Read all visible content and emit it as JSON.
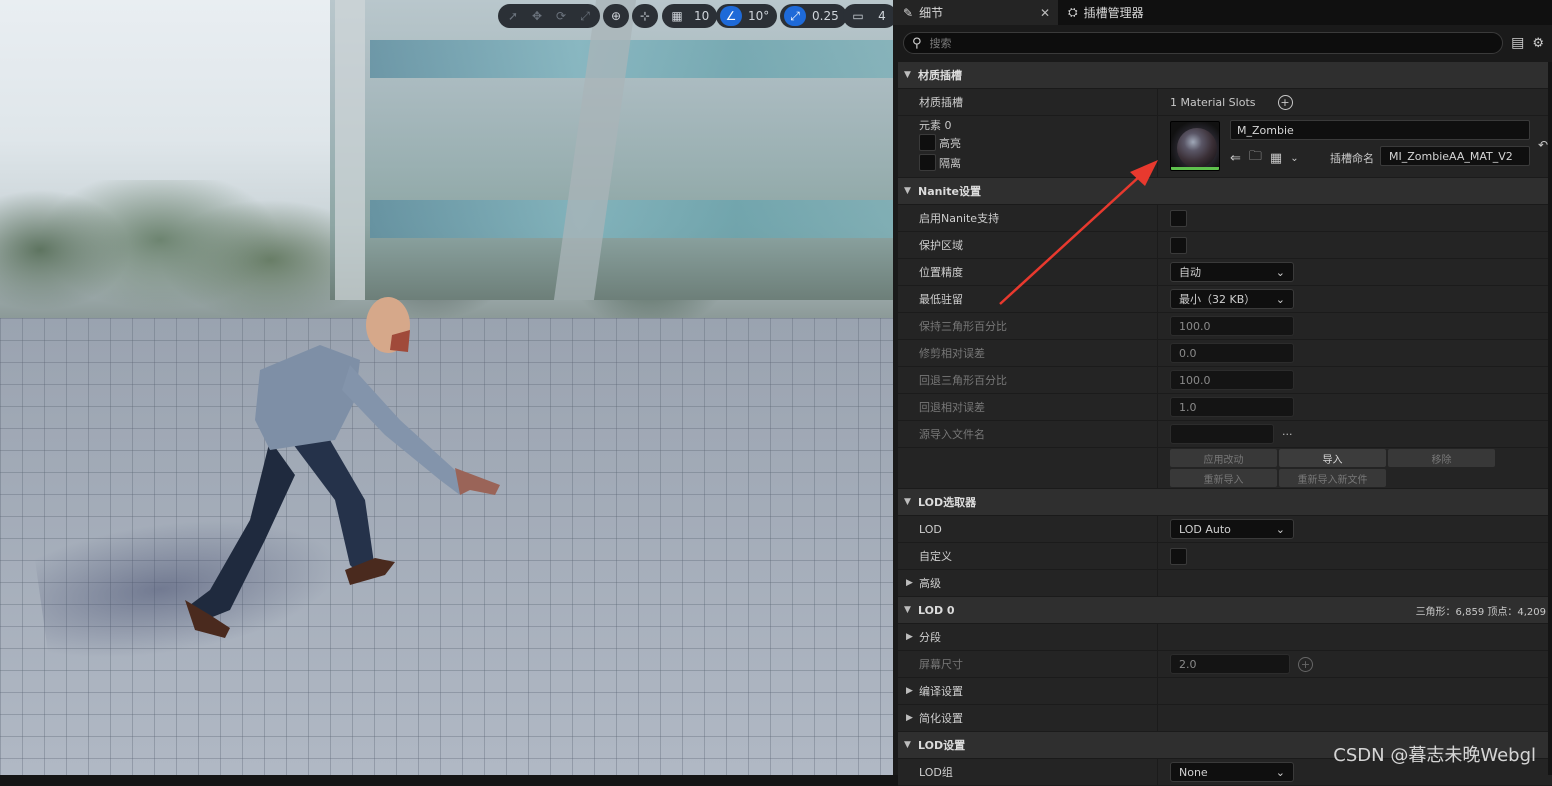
{
  "viewport": {
    "toolbar": {
      "grid_value": "10",
      "angle_value": "10°",
      "scale_value": "0.25",
      "camera_value": "4"
    }
  },
  "tabs": [
    {
      "label": "细节",
      "icon": "pencil-icon"
    },
    {
      "label": "插槽管理器",
      "icon": "socket-icon"
    }
  ],
  "search": {
    "placeholder": "搜索"
  },
  "sections": {
    "material": {
      "title": "材质插槽",
      "slots_label": "材质插槽",
      "slots_value": "1 Material Slots",
      "element_label": "元素 0",
      "highlight_label": "高亮",
      "isolate_label": "隔离",
      "material_name": "M_Zombie",
      "slot_name_label": "插槽命名",
      "slot_name_value": "MI_ZombieAA_MAT_V2"
    },
    "nanite": {
      "title": "Nanite设置",
      "enable_label": "启用Nanite支持",
      "preserve_label": "保护区域",
      "pos_precision_label": "位置精度",
      "pos_precision_value": "自动",
      "min_resident_label": "最低驻留",
      "min_resident_value": "最小（32 KB）",
      "keep_tri_label": "保持三角形百分比",
      "keep_tri_value": "100.0",
      "trim_err_label": "修剪相对误差",
      "trim_err_value": "0.0",
      "fallback_tri_label": "回退三角形百分比",
      "fallback_tri_value": "100.0",
      "fallback_err_label": "回退相对误差",
      "fallback_err_value": "1.0",
      "source_file_label": "源导入文件名",
      "source_file_value": "",
      "apply_btn": "应用改动",
      "import_btn": "导入",
      "remove_btn": "移除",
      "reimport_btn": "重新导入",
      "reimport_new_btn": "重新导入新文件"
    },
    "lod_picker": {
      "title": "LOD选取器",
      "lod_label": "LOD",
      "lod_value": "LOD Auto",
      "custom_label": "自定义",
      "advanced_label": "高级"
    },
    "lod0": {
      "title": "LOD 0",
      "stats": "三角形：6,859   顶点：4,209",
      "sections_label": "分段",
      "screen_size_label": "屏幕尺寸",
      "screen_size_value": "2.0",
      "build_label": "编译设置",
      "reduction_label": "简化设置"
    },
    "lod_settings": {
      "title": "LOD设置",
      "lod_group_label": "LOD组",
      "lod_group_value": "None"
    }
  },
  "watermark": "CSDN @暮志未晚Webgl"
}
